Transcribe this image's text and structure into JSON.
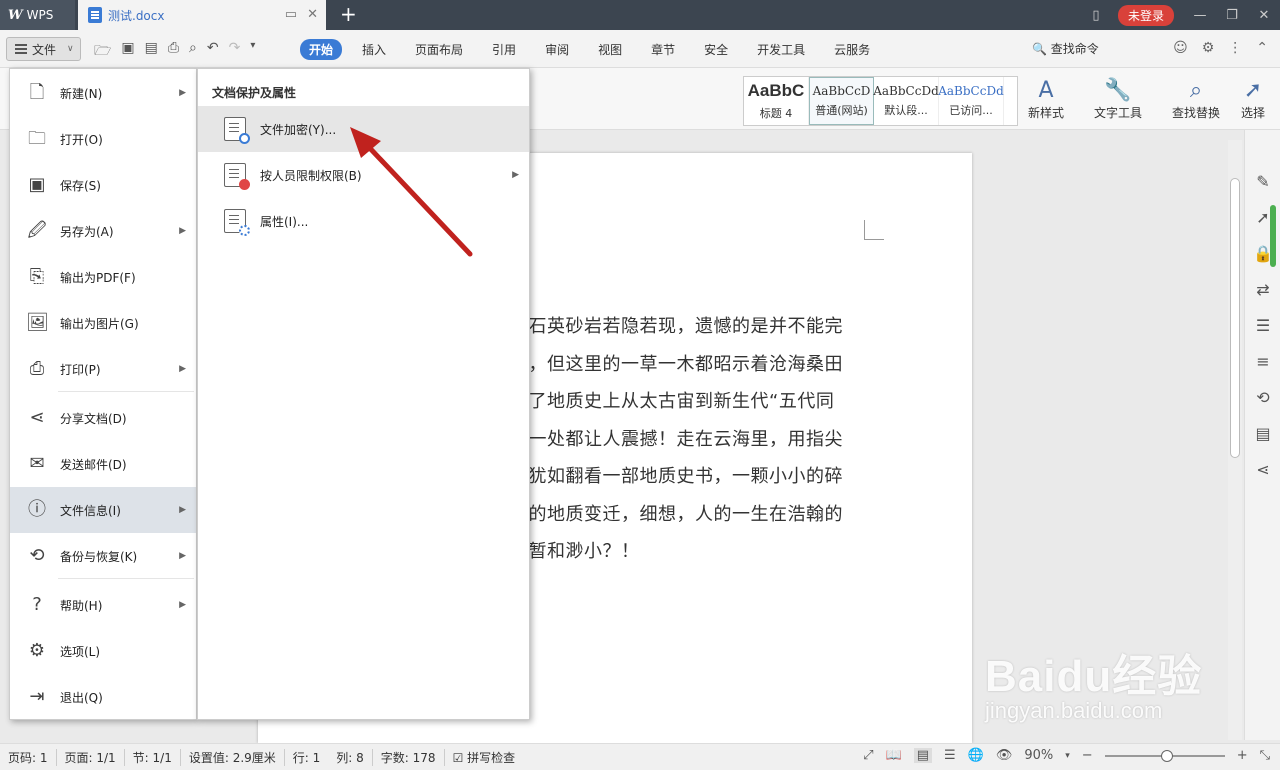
{
  "titlebar": {
    "app_tab": "WPS",
    "doc_tab": "测试.docx",
    "login_button": "未登录"
  },
  "menubar": {
    "file_button": "文件",
    "tabs": [
      "开始",
      "插入",
      "页面布局",
      "引用",
      "审阅",
      "视图",
      "章节",
      "安全",
      "开发工具",
      "云服务"
    ],
    "active_tab": "开始",
    "search_command": "查找命令"
  },
  "ribbon": {
    "styles": [
      {
        "sample": "AaBbC",
        "label": "标题 4"
      },
      {
        "sample": "AaBbCcD",
        "label": "普通(网站)"
      },
      {
        "sample": "AaBbCcDd",
        "label": "默认段..."
      },
      {
        "sample": "AaBbCcDd",
        "label": "已访问..."
      }
    ],
    "new_style": "新样式",
    "text_tools": "文字工具",
    "find_replace": "查找替换",
    "select": "选择"
  },
  "file_menu": {
    "items": [
      {
        "label": "新建(N)",
        "icon": "new-doc-icon",
        "submenu": true
      },
      {
        "label": "打开(O)",
        "icon": "folder-icon",
        "submenu": false
      },
      {
        "label": "保存(S)",
        "icon": "save-icon",
        "submenu": false
      },
      {
        "label": "另存为(A)",
        "icon": "save-as-icon",
        "submenu": true
      },
      {
        "label": "输出为PDF(F)",
        "icon": "pdf-icon",
        "submenu": false
      },
      {
        "label": "输出为图片(G)",
        "icon": "image-icon",
        "submenu": false
      },
      {
        "label": "打印(P)",
        "icon": "printer-icon",
        "submenu": true
      },
      {
        "label": "分享文档(D)",
        "icon": "share-icon",
        "submenu": false
      },
      {
        "label": "发送邮件(D)",
        "icon": "mail-icon",
        "submenu": false
      },
      {
        "label": "文件信息(I)",
        "icon": "file-info-icon",
        "submenu": true,
        "highlighted": true
      },
      {
        "label": "备份与恢复(K)",
        "icon": "backup-icon",
        "submenu": true
      },
      {
        "label": "帮助(H)",
        "icon": "help-icon",
        "submenu": true
      },
      {
        "label": "选项(L)",
        "icon": "gear-icon",
        "submenu": false
      },
      {
        "label": "退出(Q)",
        "icon": "exit-icon",
        "submenu": false
      }
    ]
  },
  "sub_menu": {
    "title": "文档保护及属性",
    "items": [
      {
        "label": "文件加密(Y)...",
        "icon": "encrypt-file-icon",
        "highlighted": true
      },
      {
        "label": "按人员限制权限(B)",
        "icon": "restrict-permission-icon",
        "submenu": true
      },
      {
        "label": "属性(I)...",
        "icon": "properties-icon"
      }
    ]
  },
  "document": {
    "lines": [
      "的石英砂岩若隐若现，遗憾的是并不能完",
      "目，但这里的一草一木都昭示着沧海桑田",
      "留了地质史上从太古宙到新生代“五代同",
      "每一处都让人震撼！走在云海里，用指尖",
      "，犹如翻看一部地质史书，一颗小小的碎",
      "大的地质变迁，细想，人的一生在浩翰的",
      "短暂和渺小？！"
    ]
  },
  "statusbar": {
    "page_num": "页码: 1",
    "page": "页面: 1/1",
    "section": "节: 1/1",
    "setting": "设置值: 2.9厘米",
    "row": "行: 1",
    "col": "列: 8",
    "word_count": "字数: 178",
    "spellcheck": "拼写检查",
    "zoom": "90%"
  },
  "watermark": {
    "brand": "Baidu经验",
    "url": "jingyan.baidu.com"
  }
}
